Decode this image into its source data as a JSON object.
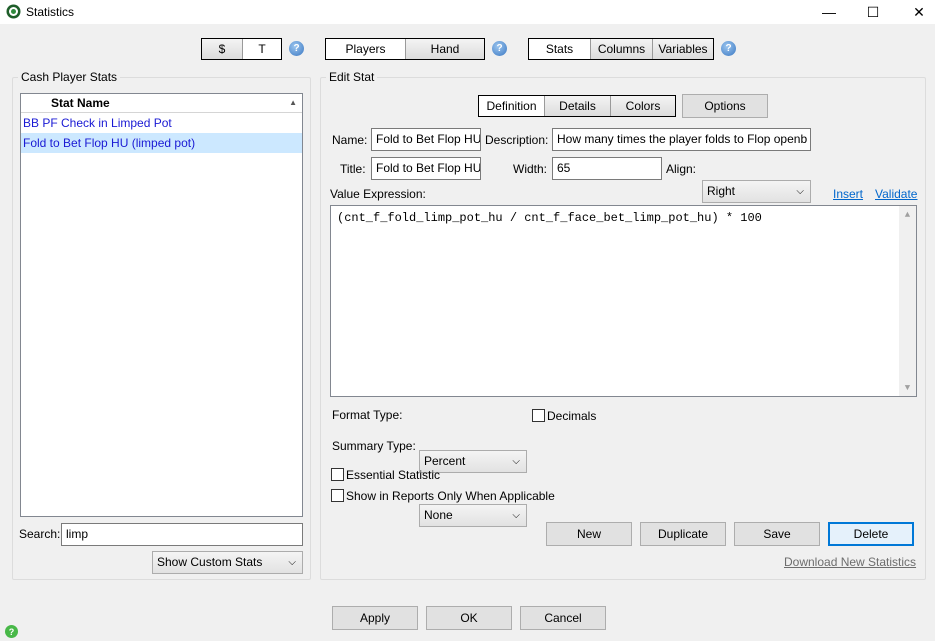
{
  "window": {
    "title": "Statistics",
    "minimize": "—",
    "maximize": "☐",
    "close": "✕"
  },
  "toolbar": {
    "group1": [
      "$",
      "T"
    ],
    "group2": [
      "Players",
      "Hand"
    ],
    "group3": [
      "Stats",
      "Columns",
      "Variables"
    ],
    "help": "?"
  },
  "left": {
    "group_label": "Cash Player Stats",
    "list_header": "Stat Name",
    "sort_glyph": "▲",
    "items": [
      "BB PF Check in Limped Pot",
      "Fold to Bet Flop HU (limped pot)"
    ],
    "search_label": "Search:",
    "search_value": "limp",
    "filter_value": "Show Custom Stats"
  },
  "edit": {
    "group_label": "Edit Stat",
    "tabs": [
      "Definition",
      "Details",
      "Colors"
    ],
    "options_label": "Options",
    "name_label": "Name:",
    "name_value": "Fold to Bet Flop HU",
    "description_label": "Description:",
    "description_value": "How many times the player folds to Flop openb",
    "title_label": "Title:",
    "title_value": "Fold to Bet Flop HU",
    "width_label": "Width:",
    "width_value": "65",
    "align_label": "Align:",
    "align_value": "Right",
    "value_expression_label": "Value Expression:",
    "insert_link": "Insert",
    "validate_link": "Validate",
    "expression": "(cnt_f_fold_limp_pot_hu / cnt_f_face_bet_limp_pot_hu) * 100",
    "format_type_label": "Format Type:",
    "format_type_value": "Percent",
    "decimals_label": "Decimals",
    "summary_type_label": "Summary Type:",
    "summary_type_value": "None",
    "essential_label": "Essential Statistic",
    "reports_only_label": "Show in Reports Only When Applicable",
    "buttons": {
      "new": "New",
      "duplicate": "Duplicate",
      "save": "Save",
      "delete": "Delete"
    },
    "download_link": "Download New Statistics"
  },
  "footer": {
    "apply": "Apply",
    "ok": "OK",
    "cancel": "Cancel"
  },
  "icons": {
    "dropdown": "⌵",
    "scroll_up": "▲",
    "scroll_down": "▼"
  },
  "colors": {
    "accent": "#0078d7",
    "list_text": "#1a1ad4",
    "selected_row": "#cce8ff",
    "link": "#0066cc"
  }
}
